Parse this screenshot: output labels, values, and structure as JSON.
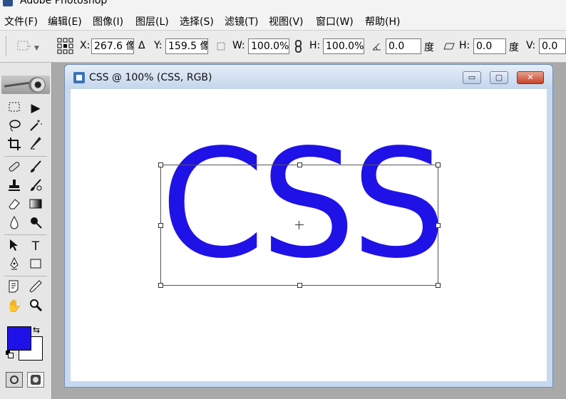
{
  "app": {
    "title": "Adobe Photoshop"
  },
  "menu": [
    "文件(F)",
    "编辑(E)",
    "图像(I)",
    "图层(L)",
    "选择(S)",
    "滤镜(T)",
    "视图(V)",
    "窗口(W)",
    "帮助(H)"
  ],
  "options": {
    "x_label": "X:",
    "x_value": "267.6 像",
    "delta_symbol": "Δ",
    "y_label": "Y:",
    "y_value": "159.5 像",
    "w_label": "W:",
    "w_value": "100.0%",
    "h_label": "H:",
    "h_value": "100.0%",
    "angle_value": "0.0",
    "angle_unit": "度",
    "skew_h_label": "H:",
    "skew_h_value": "0.0",
    "skew_h_unit": "度",
    "skew_v_label": "V:",
    "skew_v_value": "0.0"
  },
  "document": {
    "title": "CSS @ 100% (CSS, RGB)",
    "text": "CSS"
  },
  "colors": {
    "foreground": "#1f12e6",
    "background": "#ffffff",
    "text": "#1f12e6"
  },
  "tools": {
    "move": "▶",
    "type": "T",
    "hand": "✋",
    "zoom": "🔍"
  }
}
